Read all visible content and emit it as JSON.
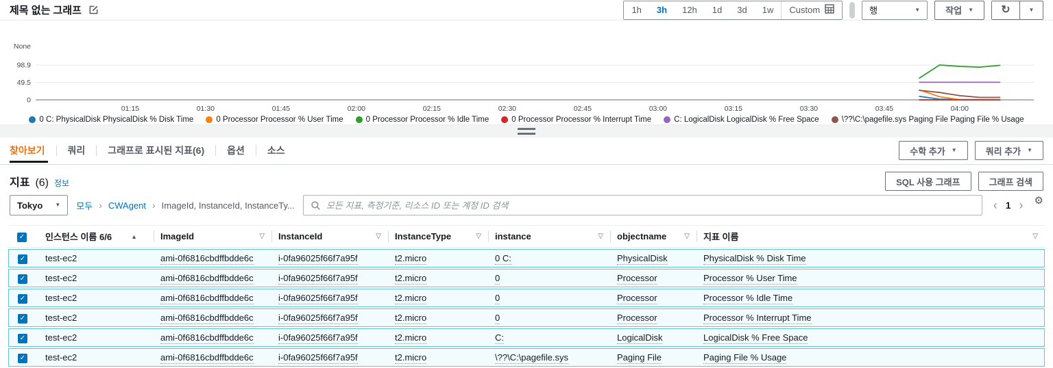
{
  "icons": {
    "caret_down": "▼",
    "sort_asc": "▲",
    "filter": "▽",
    "refresh": "↻",
    "gear": "⚙",
    "check": "✓",
    "chevron_left": "‹",
    "chevron_right": "›",
    "crumb_sep": "›"
  },
  "colors": {
    "link": "#0073bb",
    "active_tab": "#ec7211",
    "row_bg": "#f2fbfd",
    "row_border": "#5fc3dd",
    "checkbox": "#0073bb"
  },
  "header": {
    "title": "제목 없는 그래프",
    "time_ranges": [
      "1h",
      "3h",
      "12h",
      "1d",
      "3d",
      "1w"
    ],
    "selected_range": "3h",
    "custom_label": "Custom",
    "graph_type": "행",
    "actions_label": "작업"
  },
  "chart_data": {
    "type": "line",
    "title": "제목 없는 그래프",
    "ylabel": "None",
    "yticks": [
      0,
      49.5,
      98.9
    ],
    "ylim": [
      0,
      110
    ],
    "grid": "horizontal",
    "legend_position": "bottom",
    "xticks": [
      "01:15",
      "01:30",
      "01:45",
      "02:00",
      "02:15",
      "02:30",
      "02:45",
      "03:00",
      "03:15",
      "03:30",
      "03:45",
      "04:00"
    ],
    "x_domain_minutes": [
      56,
      255
    ],
    "x_minutes": [
      232,
      236,
      240,
      244,
      248
    ],
    "series": [
      {
        "name": "0 C: PhysicalDisk PhysicalDisk % Disk Time",
        "color": "#1f77b4",
        "values": [
          10,
          2,
          0.8,
          0.8,
          0.8
        ]
      },
      {
        "name": "0 Processor Processor % User Time",
        "color": "#ff7f0e",
        "values": [
          28,
          9,
          0.5,
          0.5,
          0.5
        ]
      },
      {
        "name": "0 Processor Processor % Idle Time",
        "color": "#2ca02c",
        "values": [
          62,
          99,
          95,
          93,
          98
        ]
      },
      {
        "name": "0 Processor Processor % Interrupt Time",
        "color": "#d62728",
        "values": [
          0.3,
          0.3,
          0.3,
          0.3,
          0.3
        ]
      },
      {
        "name": "C: LogicalDisk LogicalDisk % Free Space",
        "color": "#9467bd",
        "values": [
          50,
          50,
          50,
          50,
          50
        ]
      },
      {
        "name": "\\??\\C:\\pagefile.sys Paging File Paging File % Usage",
        "color": "#8c564b",
        "values": [
          27,
          21,
          12,
          7,
          7
        ]
      }
    ]
  },
  "tabs": {
    "items": [
      "찾아보기",
      "쿼리",
      "그래프로 표시된 지표(6)",
      "옵션",
      "소스"
    ],
    "active": "찾아보기",
    "add_math_label": "수학 추가",
    "add_query_label": "쿼리 추가"
  },
  "metrics": {
    "title": "지표",
    "count": "(6)",
    "info_label": "정보",
    "sql_button": "SQL 사용 그래프",
    "search_graph_button": "그래프 검색",
    "region": "Tokyo",
    "breadcrumbs": [
      "모두",
      "CWAgent",
      "ImageId, InstanceId, InstanceTy..."
    ],
    "search_placeholder": "모든 지표, 측정기준, 리소스 ID 또는 계정 ID 검색",
    "page": "1"
  },
  "table": {
    "columns": [
      {
        "label": "인스턴스 이름 6/6",
        "sort": "asc"
      },
      {
        "label": "ImageId",
        "filter": true
      },
      {
        "label": "InstanceId",
        "filter": true
      },
      {
        "label": "InstanceType",
        "filter": true
      },
      {
        "label": "instance",
        "filter": true
      },
      {
        "label": "objectname",
        "filter": true
      },
      {
        "label": "지표 이름",
        "filter": true
      }
    ],
    "rows": [
      {
        "checked": true,
        "name": "test-ec2",
        "image_id": "ami-0f6816cbdffbdde6c",
        "instance_id": "i-0fa96025f66f7a95f",
        "instance_type": "t2.micro",
        "instance": "0 C:",
        "objectname": "PhysicalDisk",
        "metric": "PhysicalDisk % Disk Time"
      },
      {
        "checked": true,
        "name": "test-ec2",
        "image_id": "ami-0f6816cbdffbdde6c",
        "instance_id": "i-0fa96025f66f7a95f",
        "instance_type": "t2.micro",
        "instance": "0",
        "objectname": "Processor",
        "metric": "Processor % User Time"
      },
      {
        "checked": true,
        "name": "test-ec2",
        "image_id": "ami-0f6816cbdffbdde6c",
        "instance_id": "i-0fa96025f66f7a95f",
        "instance_type": "t2.micro",
        "instance": "0",
        "objectname": "Processor",
        "metric": "Processor % Idle Time"
      },
      {
        "checked": true,
        "name": "test-ec2",
        "image_id": "ami-0f6816cbdffbdde6c",
        "instance_id": "i-0fa96025f66f7a95f",
        "instance_type": "t2.micro",
        "instance": "0",
        "objectname": "Processor",
        "metric": "Processor % Interrupt Time"
      },
      {
        "checked": true,
        "name": "test-ec2",
        "image_id": "ami-0f6816cbdffbdde6c",
        "instance_id": "i-0fa96025f66f7a95f",
        "instance_type": "t2.micro",
        "instance": "C:",
        "objectname": "LogicalDisk",
        "metric": "LogicalDisk % Free Space"
      },
      {
        "checked": true,
        "name": "test-ec2",
        "image_id": "ami-0f6816cbdffbdde6c",
        "instance_id": "i-0fa96025f66f7a95f",
        "instance_type": "t2.micro",
        "instance": "\\??\\C:\\pagefile.sys",
        "objectname": "Paging File",
        "metric": "Paging File % Usage"
      }
    ]
  }
}
